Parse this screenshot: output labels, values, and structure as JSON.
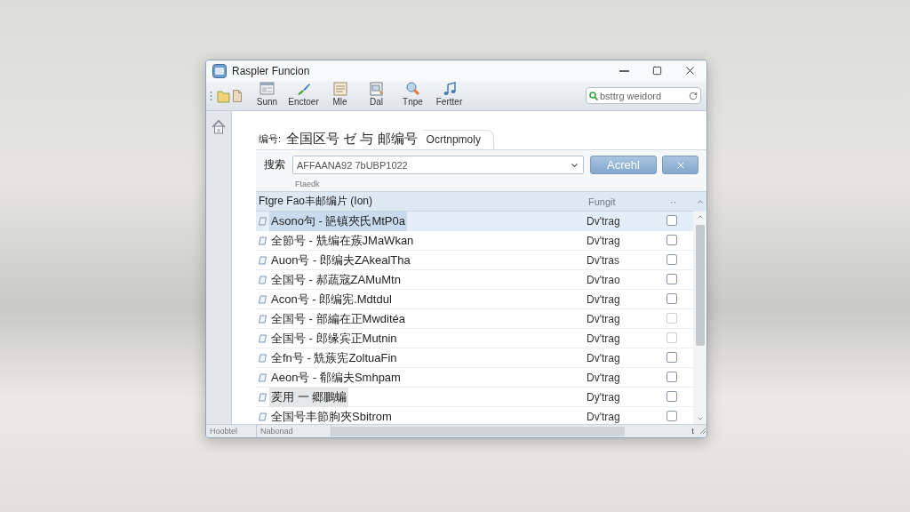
{
  "window": {
    "title": "Raspler Funcion"
  },
  "toolbar": {
    "items": [
      {
        "label": "Sunn"
      },
      {
        "label": "Enctoer"
      },
      {
        "label": "Mle"
      },
      {
        "label": "Dal"
      },
      {
        "label": "Tnpe"
      },
      {
        "label": "Fertter"
      }
    ],
    "search": {
      "placeholder": "bsttrg weidord"
    }
  },
  "heading": {
    "label": "编号:",
    "title": "全国区号 ゼ 与 邮编号",
    "tab": "Ocrtnpmoly"
  },
  "search": {
    "label": "搜索",
    "value": "AFFAANA92 7bUBP1022",
    "button": "Acrehl",
    "hint": "Ftaedk"
  },
  "table": {
    "columns": [
      "Ftgre Fao丰邮编片 (Ion)",
      "Fungit",
      "··"
    ],
    "rows": [
      {
        "name": "Asono句 - 郶镇夾氏MtP0a",
        "status": "Dv'trag",
        "checked": false,
        "disabled": false,
        "selected": true,
        "focused": false
      },
      {
        "name": "全節号 - 兟编在蔟JMaWkan",
        "status": "Dv'trag",
        "checked": false,
        "disabled": false,
        "selected": false,
        "focused": false
      },
      {
        "name": "Auon号 - 郎编夫ZAkealTha",
        "status": "Dv'tras",
        "checked": false,
        "disabled": false,
        "selected": false,
        "focused": false
      },
      {
        "name": "全国号 - 郝蔬宼ZAMuMtn",
        "status": "Dv'trao",
        "checked": false,
        "disabled": false,
        "selected": false,
        "focused": false
      },
      {
        "name": "Acon号 - 郎编宪.Mdtdul",
        "status": "Dv'trag",
        "checked": false,
        "disabled": false,
        "selected": false,
        "focused": false
      },
      {
        "name": "全国号 - 部編在正Mwditéa",
        "status": "Dv'trag",
        "checked": false,
        "disabled": true,
        "selected": false,
        "focused": false
      },
      {
        "name": "全国号 - 郎缘宾正Mutnin",
        "status": "Dv'trag",
        "checked": false,
        "disabled": true,
        "selected": false,
        "focused": false
      },
      {
        "name": "全fn号 - 兟蔟宪ZoltuaFin",
        "status": "Dv'trag",
        "checked": false,
        "disabled": false,
        "selected": false,
        "focused": false
      },
      {
        "name": "Aeon号 - 郩编夫Smhpam",
        "status": "Dv'trag",
        "checked": false,
        "disabled": false,
        "selected": false,
        "focused": false
      },
      {
        "name": "羐用 一 郷鵬蝙",
        "status": "Dy'trag",
        "checked": false,
        "disabled": false,
        "selected": false,
        "focused": true
      },
      {
        "name": "全国号丰節朐夾Sbitrom",
        "status": "Dv'trag",
        "checked": false,
        "disabled": false,
        "selected": false,
        "focused": false
      }
    ]
  },
  "status_bar": {
    "items": [
      "Hoobtel",
      "Nabonad"
    ],
    "corner": "t"
  }
}
